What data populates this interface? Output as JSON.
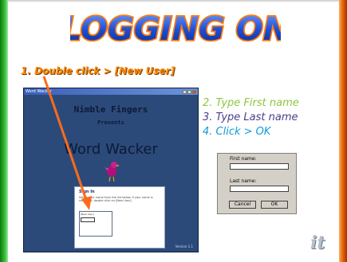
{
  "title": {
    "text": "LOGGING ON"
  },
  "step1": {
    "text": "1.  Double click  > [New User]"
  },
  "app_window": {
    "title": "Word Wacker",
    "heading1": "Nimble Fingers",
    "heading2": "Presents",
    "heading3": "Word Wacker",
    "sign_in": {
      "title": "Sign In",
      "text": "Select your name from the list below. If your name is not listed, double click on [New User].",
      "list_item": "[New User]"
    },
    "version": "Version 1.1"
  },
  "steps": [
    {
      "text": "2.  Type First name"
    },
    {
      "text": "3.  Type Last name"
    },
    {
      "text": "4.  Click > OK"
    }
  ],
  "dialog": {
    "first_name_label": "First name:",
    "last_name_label": "Last name:",
    "first_name_value": "",
    "last_name_value": "",
    "cancel_label": "Cancel",
    "ok_label": "OK"
  },
  "logo": {
    "text": "it"
  },
  "colors": {
    "left_bar": "#42c942",
    "right_bar": "#ea6f0d",
    "title_fill": "#1f4fd4",
    "title_outline": "#ff7b0d",
    "arrow": "#ff6a1a",
    "step_green": "#8dc63f",
    "step_purple": "#4a3c8a",
    "step_blue": "#0d9bd6"
  }
}
